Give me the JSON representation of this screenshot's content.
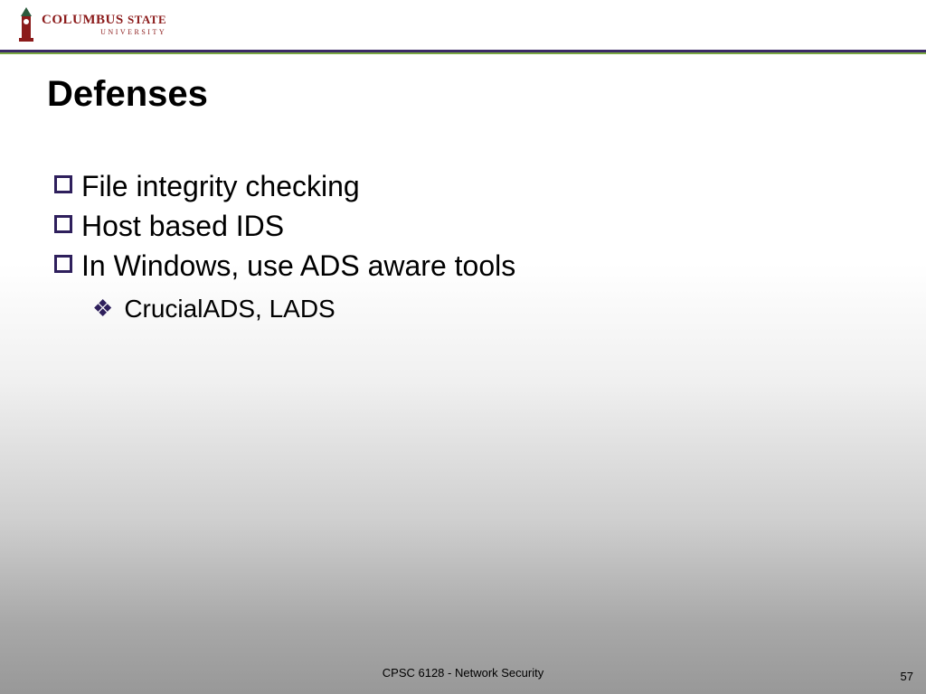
{
  "logo": {
    "line1_main": "COLUMBUS ",
    "line1_tail": "STATE",
    "line2": "UNIVERSITY"
  },
  "title": "Defenses",
  "bullets": {
    "b0": "File integrity checking",
    "b1": "Host based IDS",
    "b2": "In Windows, use ADS aware tools"
  },
  "sub": {
    "s0": "CrucialADS, LADS"
  },
  "footer": {
    "course": "CPSC 6128 - Network Security",
    "page": "57"
  }
}
